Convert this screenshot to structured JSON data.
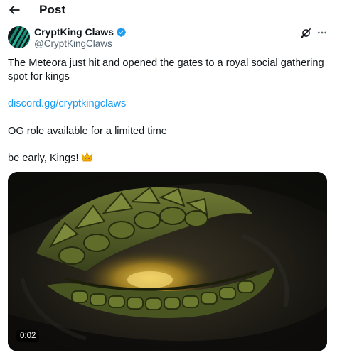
{
  "header": {
    "title": "Post"
  },
  "author": {
    "name": "CryptKing Claws",
    "handle": "@CryptKingClaws",
    "verified": true
  },
  "post": {
    "line1": "The Meteora just hit and opened the gates to a royal social gathering",
    "line2": "spot for kings",
    "link": "discord.gg/cryptkingclaws",
    "line4": "OG role available for a limited time",
    "line5": "be early, Kings!",
    "emoji": "crown-emoji"
  },
  "media": {
    "type": "video",
    "duration": "0:02",
    "thumbnail": "green-dragon-eye"
  },
  "colors": {
    "link": "#1d9bf0",
    "secondary_text": "#536471",
    "verified_badge": "#1d9bf0"
  }
}
